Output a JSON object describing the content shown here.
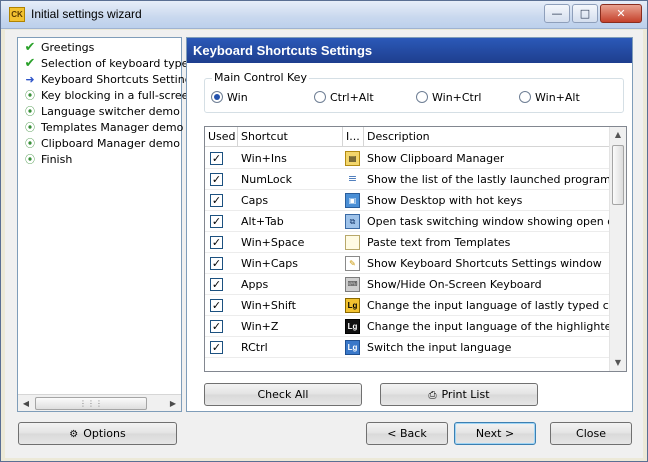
{
  "window": {
    "title": "Initial settings wizard",
    "app_icon": "CK"
  },
  "nav": {
    "items": [
      {
        "label": "Greetings",
        "icon": "check-icon",
        "state": "done"
      },
      {
        "label": "Selection of keyboard type",
        "icon": "check-icon",
        "state": "done"
      },
      {
        "label": "Keyboard Shortcuts Settings",
        "icon": "arrow-right-icon",
        "state": "current"
      },
      {
        "label": "Key blocking in a full-screen",
        "icon": "pending-icon",
        "state": "pending"
      },
      {
        "label": "Language switcher demo",
        "icon": "pending-icon",
        "state": "pending"
      },
      {
        "label": "Templates Manager demo",
        "icon": "pending-icon",
        "state": "pending"
      },
      {
        "label": "Clipboard Manager demo",
        "icon": "pending-icon",
        "state": "pending"
      },
      {
        "label": "Finish",
        "icon": "pending-icon",
        "state": "pending"
      }
    ]
  },
  "panel": {
    "title": "Keyboard Shortcuts Settings",
    "main_key": {
      "label": "Main Control Key",
      "options": [
        {
          "label": "Win",
          "checked": true
        },
        {
          "label": "Ctrl+Alt",
          "checked": false
        },
        {
          "label": "Win+Ctrl",
          "checked": false
        },
        {
          "label": "Win+Alt",
          "checked": false
        }
      ]
    },
    "table": {
      "columns": [
        "Used",
        "Shortcut",
        "I...",
        "Description"
      ],
      "rows": [
        {
          "used": true,
          "shortcut": "Win+Ins",
          "icon": "clipboard-icon",
          "description": "Show Clipboard Manager"
        },
        {
          "used": true,
          "shortcut": "NumLock",
          "icon": "list-icon",
          "description": "Show the list of the lastly launched programs"
        },
        {
          "used": true,
          "shortcut": "Caps",
          "icon": "desktop-icon",
          "description": "Show Desktop with hot keys"
        },
        {
          "used": true,
          "shortcut": "Alt+Tab",
          "icon": "task-switch-icon",
          "description": "Open task switching window showing open doc..."
        },
        {
          "used": true,
          "shortcut": "Win+Space",
          "icon": "document-icon",
          "description": "Paste text from Templates"
        },
        {
          "used": true,
          "shortcut": "Win+Caps",
          "icon": "settings-window-icon",
          "description": "Show Keyboard Shortcuts Settings window"
        },
        {
          "used": true,
          "shortcut": "Apps",
          "icon": "keyboard-icon",
          "description": "Show/Hide On-Screen Keyboard"
        },
        {
          "used": true,
          "shortcut": "Win+Shift",
          "icon": "lg-yellow-icon",
          "description": "Change the input language of lastly typed char..."
        },
        {
          "used": true,
          "shortcut": "Win+Z",
          "icon": "lg-black-icon",
          "description": "Change the input language of the highlighted c..."
        },
        {
          "used": true,
          "shortcut": "RCtrl",
          "icon": "lg-blue-icon",
          "description": "Switch the input language"
        }
      ]
    },
    "check_all_label": "Check All",
    "print_list_label": "Print List"
  },
  "footer": {
    "options_label": "Options",
    "back_label": "< Back",
    "next_label": "Next >",
    "close_label": "Close"
  },
  "colors": {
    "header_blue": "#2b59b8",
    "check_green": "#2aa12a"
  }
}
